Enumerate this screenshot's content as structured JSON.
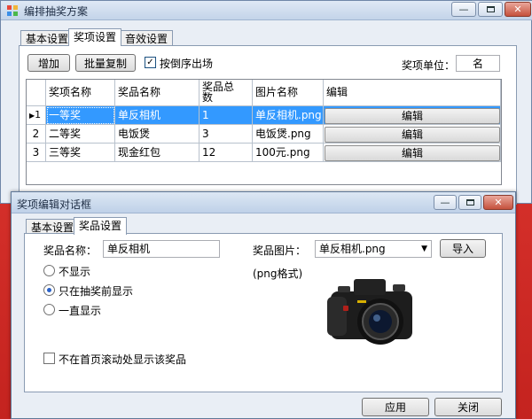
{
  "main_window": {
    "title": "编排抽奖方案",
    "tabs": [
      "基本设置",
      "奖项设置",
      "音效设置"
    ],
    "toolbar": {
      "add_label": "增加",
      "batch_copy_label": "批量复制",
      "reverse_checkbox_label": "按倒序出场",
      "reverse_checked": true,
      "unit_label": "奖项单位：",
      "unit_value": "名"
    },
    "grid": {
      "columns": [
        "奖项名称",
        "奖品名称",
        "奖品总数",
        "图片名称",
        "编辑"
      ],
      "rows": [
        {
          "num": "1",
          "award": "一等奖",
          "prize": "单反相机",
          "count": "1",
          "image": "单反相机.png",
          "edit": "编辑",
          "selected": true
        },
        {
          "num": "2",
          "award": "二等奖",
          "prize": "电饭煲",
          "count": "3",
          "image": "电饭煲.png",
          "edit": "编辑",
          "selected": false
        },
        {
          "num": "3",
          "award": "三等奖",
          "prize": "现金红包",
          "count": "12",
          "image": "100元.png",
          "edit": "编辑",
          "selected": false
        }
      ]
    }
  },
  "dialog": {
    "title": "奖项编辑对话框",
    "tabs": [
      "基本设置",
      "奖品设置"
    ],
    "prize_name_label": "奖品名称：",
    "prize_name_value": "单反相机",
    "prize_image_label": "奖品图片：",
    "prize_image_value": "单反相机.png",
    "import_label": "导入",
    "format_hint": "(png格式)",
    "radios": [
      {
        "label": "不显示",
        "checked": false
      },
      {
        "label": "只在抽奖前显示",
        "checked": true
      },
      {
        "label": "一直显示",
        "checked": false
      }
    ],
    "hide_scroll_label": "不在首页滚动处显示该奖品",
    "hide_scroll_checked": false,
    "apply_label": "应用",
    "close_label": "关闭"
  },
  "colors": {
    "selection": "#3399ff",
    "background_red": "#d42b25"
  }
}
